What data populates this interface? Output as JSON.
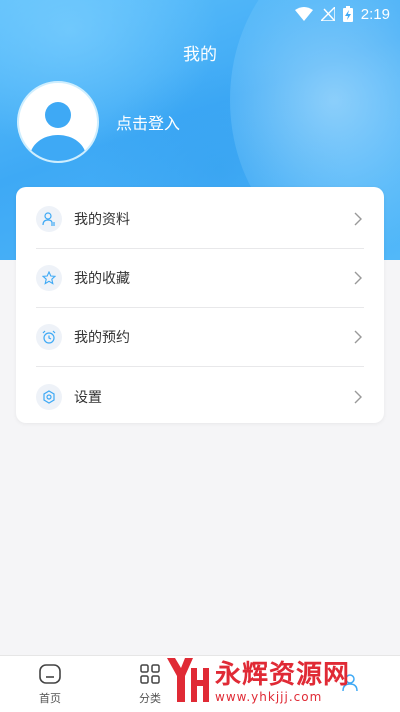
{
  "status_bar": {
    "time": "2:19",
    "icons": [
      "wifi-icon",
      "no-signal-icon",
      "battery-charging-icon"
    ]
  },
  "header": {
    "title": "我的"
  },
  "profile": {
    "avatar_icon": "default-user-avatar-icon",
    "login_label": "点击登入"
  },
  "menu": {
    "items": [
      {
        "label": "我的资料",
        "icon": "user-profile-icon"
      },
      {
        "label": "我的收藏",
        "icon": "star-icon"
      },
      {
        "label": "我的预约",
        "icon": "alarm-clock-icon"
      },
      {
        "label": "设置",
        "icon": "settings-gear-icon"
      }
    ]
  },
  "bottom_nav": {
    "items": [
      {
        "label": "首页",
        "icon": "home-icon",
        "active": false
      },
      {
        "label": "分类",
        "icon": "category-grid-icon",
        "active": false
      },
      {
        "label": "",
        "icon": "",
        "active": false
      },
      {
        "label": "",
        "icon": "profile-icon",
        "active": true
      }
    ]
  },
  "watermark": {
    "logo_text": "YH",
    "title": "永辉资源网",
    "url": "www.yhkjjj.com"
  },
  "colors": {
    "accent": "#3ea9f5",
    "header_gradient_start": "#5ec0fb",
    "watermark_red": "#e02a35",
    "background": "#f5f5f7"
  }
}
